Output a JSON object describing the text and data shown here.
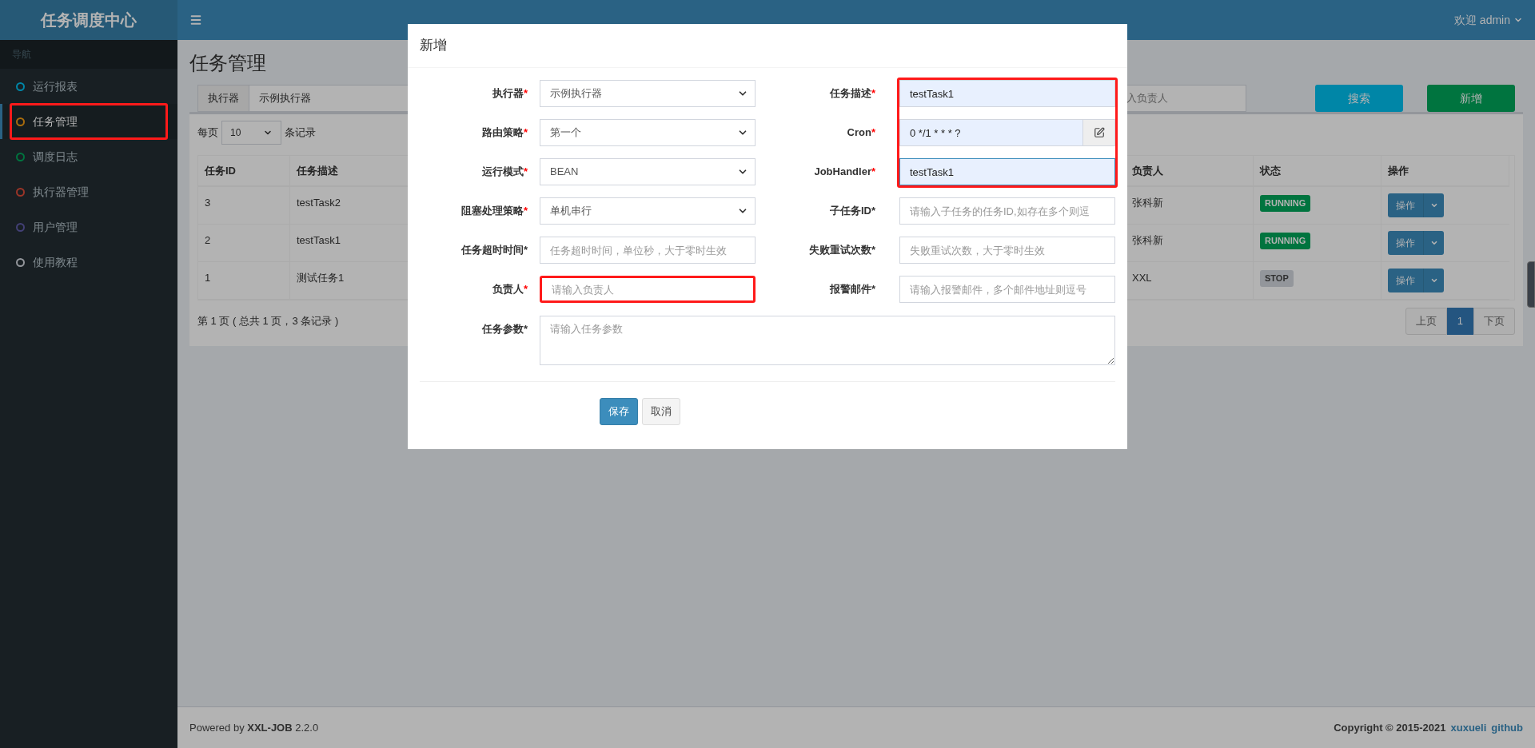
{
  "header": {
    "logo": "任务调度中心",
    "user": "欢迎 admin"
  },
  "sidebar": {
    "heading": "导航",
    "items": [
      {
        "label": "运行报表",
        "color": "#0086a7",
        "selected": false,
        "highlighted": false
      },
      {
        "label": "任务管理",
        "color": "#aa6d0d",
        "selected": true,
        "highlighted": true
      },
      {
        "label": "调度日志",
        "color": "#00743f",
        "selected": false,
        "highlighted": false
      },
      {
        "label": "执行器管理",
        "color": "#9b3528",
        "selected": false,
        "highlighted": false
      },
      {
        "label": "用户管理",
        "color": "#434076",
        "selected": false,
        "highlighted": false
      },
      {
        "label": "使用教程",
        "color": "#93969b",
        "selected": false,
        "highlighted": false
      }
    ]
  },
  "page": {
    "title": "任务管理",
    "filter": {
      "executor_label": "执行器",
      "executor_value": "示例执行器",
      "owner_placeholder": "入负责人",
      "search_button": "搜索",
      "add_button": "新增"
    },
    "table": {
      "page_size_prefix": "每页",
      "page_size": "10",
      "page_size_suffix": "条记录",
      "columns": [
        "任务ID",
        "任务描述",
        "负责人",
        "状态",
        "操作"
      ],
      "rows": [
        {
          "id": "3",
          "description": "testTask2",
          "owner": "张科新",
          "status": "RUNNING",
          "color": "#00743f",
          "action": "操作"
        },
        {
          "id": "2",
          "description": "testTask1",
          "owner": "张科新",
          "status": "RUNNING",
          "color": "#00743f",
          "action": "操作"
        },
        {
          "id": "1",
          "description": "测试任务1",
          "owner": "XXL",
          "status": "STOP",
          "color": "#93969b",
          "action": "操作"
        }
      ],
      "summary": "第 1 页 ( 总共 1 页，3 条记录 )",
      "pagination": [
        {
          "label": "上页",
          "selected": false
        },
        {
          "label": "1",
          "selected": true
        },
        {
          "label": "下页",
          "selected": false
        }
      ]
    }
  },
  "footer": {
    "powered": "Powered by **XXL-JOB** 2.2.0",
    "copyright": "Copyright © 2015-2021",
    "links": [
      "xuxueli",
      "github"
    ]
  },
  "modal": {
    "title": "新增",
    "rows": [
      {
        "left": {
          "label": "执行器",
          "asterisk": "*",
          "required": true,
          "kind": "select",
          "value": "示例执行器",
          "highlighted": false
        },
        "right": {
          "label": "任务描述",
          "asterisk": "*",
          "required": true,
          "kind": "input",
          "value": "testTask1",
          "autofilled": true,
          "focused": false,
          "highlighted": true
        }
      },
      {
        "left": {
          "label": "路由策略",
          "asterisk": "*",
          "required": true,
          "kind": "select",
          "value": "第一个",
          "highlighted": false
        },
        "right": {
          "label": "Cron",
          "asterisk": "*",
          "required": true,
          "kind": "input_button",
          "value": "0 */1 * * * ?",
          "autofilled": true,
          "focused": false,
          "highlighted": true
        }
      },
      {
        "left": {
          "label": "运行模式",
          "asterisk": "*",
          "required": true,
          "kind": "select",
          "value": "BEAN",
          "highlighted": false
        },
        "right": {
          "label": "JobHandler",
          "asterisk": "*",
          "required": true,
          "kind": "input",
          "value": "testTask1",
          "autofilled": true,
          "focused": true,
          "highlighted": true
        }
      },
      {
        "left": {
          "label": "阻塞处理策略",
          "asterisk": "*",
          "required": true,
          "kind": "select",
          "value": "单机串行",
          "highlighted": false
        },
        "right": {
          "label": "子任务ID",
          "asterisk": "*",
          "required": false,
          "kind": "input",
          "placeholder": "请输入子任务的任务ID,如存在多个则逗",
          "autofilled": false,
          "focused": false,
          "highlighted": false
        }
      },
      {
        "left": {
          "label": "任务超时时间",
          "asterisk": "*",
          "required": false,
          "kind": "input",
          "placeholder": "任务超时时间，单位秒，大于零时生效",
          "autofilled": false,
          "focused": false,
          "highlighted": false
        },
        "right": {
          "label": "失败重试次数",
          "asterisk": "*",
          "required": false,
          "kind": "input",
          "placeholder": "失败重试次数，大于零时生效",
          "autofilled": false,
          "focused": false,
          "highlighted": false
        }
      },
      {
        "left": {
          "label": "负责人",
          "asterisk": "*",
          "required": true,
          "kind": "input",
          "placeholder": "请输入负责人",
          "autofilled": false,
          "highlighted": true
        },
        "right": {
          "label": "报警邮件",
          "asterisk": "*",
          "required": false,
          "kind": "input",
          "placeholder": "请输入报警邮件，多个邮件地址则逗号",
          "autofilled": false,
          "focused": false,
          "highlighted": false
        }
      }
    ],
    "params": {
      "label": "任务参数",
      "asterisk": "*",
      "required": false,
      "placeholder": "请输入任务参数"
    },
    "buttons": [
      {
        "label": "保存",
        "kind": "primary"
      },
      {
        "label": "取消",
        "kind": "default"
      }
    ]
  }
}
